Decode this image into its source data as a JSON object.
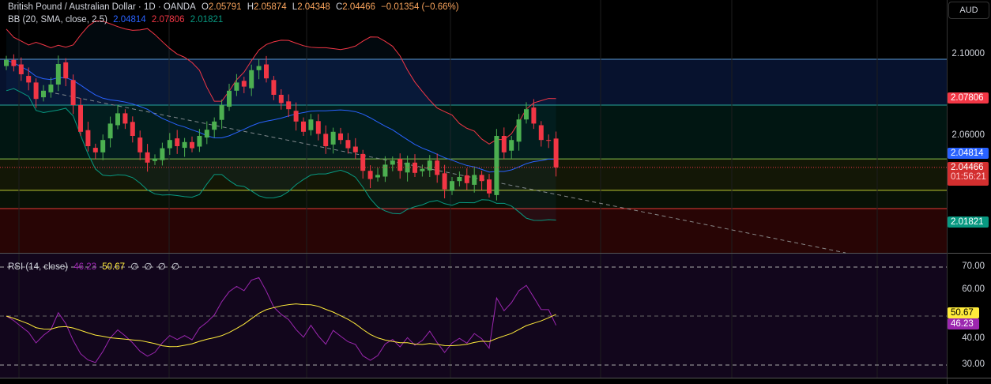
{
  "header": {
    "symbol": "British Pound / Australian Dollar · 1D · OANDA",
    "open_label": "O",
    "open": "2.05791",
    "high_label": "H",
    "high": "2.05874",
    "low_label": "L",
    "low": "2.04348",
    "close_label": "C",
    "close": "2.04466",
    "change": "−0.01354 (−0.66%)"
  },
  "bb": {
    "label": "BB (20, SMA, close, 2.5)",
    "basis": "2.04814",
    "upper": "2.07806",
    "lower": "2.01821"
  },
  "rsi": {
    "label": "RSI (14, close)",
    "value": "46.23",
    "ma": "50.67",
    "extras": [
      "∅",
      "∅",
      "∅",
      "∅"
    ]
  },
  "axis": {
    "currency": "AUD",
    "price_ticks": [
      "2.10000",
      "2.06000"
    ],
    "rsi_ticks": [
      "70.00",
      "60.00",
      "40.00",
      "30.00"
    ],
    "tags": {
      "upper": "2.07806",
      "basis": "2.04814",
      "last": "2.04466",
      "countdown": "01:56:21",
      "lower": "2.01821",
      "rsi_ma": "50.67",
      "rsi": "46.23"
    }
  },
  "colors": {
    "up": "#4caf50",
    "down": "#f23645",
    "basis": "#2962ff",
    "upper": "#f23645",
    "lower": "#089981",
    "rsi": "#9c27b0",
    "rsi_ma": "#ffeb3b"
  },
  "chart_data": {
    "type": "candlestick",
    "closes": [
      2.097,
      2.094,
      2.09,
      2.086,
      2.078,
      2.082,
      2.085,
      2.095,
      2.088,
      2.075,
      2.062,
      2.055,
      2.052,
      2.058,
      2.066,
      2.071,
      2.066,
      2.06,
      2.052,
      2.047,
      2.049,
      2.054,
      2.058,
      2.055,
      2.057,
      2.054,
      2.06,
      2.063,
      2.067,
      2.075,
      2.082,
      2.086,
      2.084,
      2.092,
      2.094,
      2.088,
      2.08,
      2.076,
      2.073,
      2.067,
      2.062,
      2.068,
      2.061,
      2.055,
      2.062,
      2.058,
      2.054,
      2.052,
      2.043,
      2.039,
      2.041,
      2.046,
      2.048,
      2.043,
      2.047,
      2.042,
      2.044,
      2.048,
      2.041,
      2.034,
      2.038,
      2.04,
      2.037,
      2.041,
      2.038,
      2.032,
      2.06,
      2.052,
      2.058,
      2.068,
      2.073,
      2.066,
      2.058,
      2.05791,
      2.04466
    ],
    "drawn_levels": [
      2.0973,
      2.075,
      2.0488,
      2.0335,
      2.0246
    ],
    "ylim": [
      2.005,
      2.11
    ],
    "rsi_levels": [
      70,
      50,
      30
    ]
  }
}
